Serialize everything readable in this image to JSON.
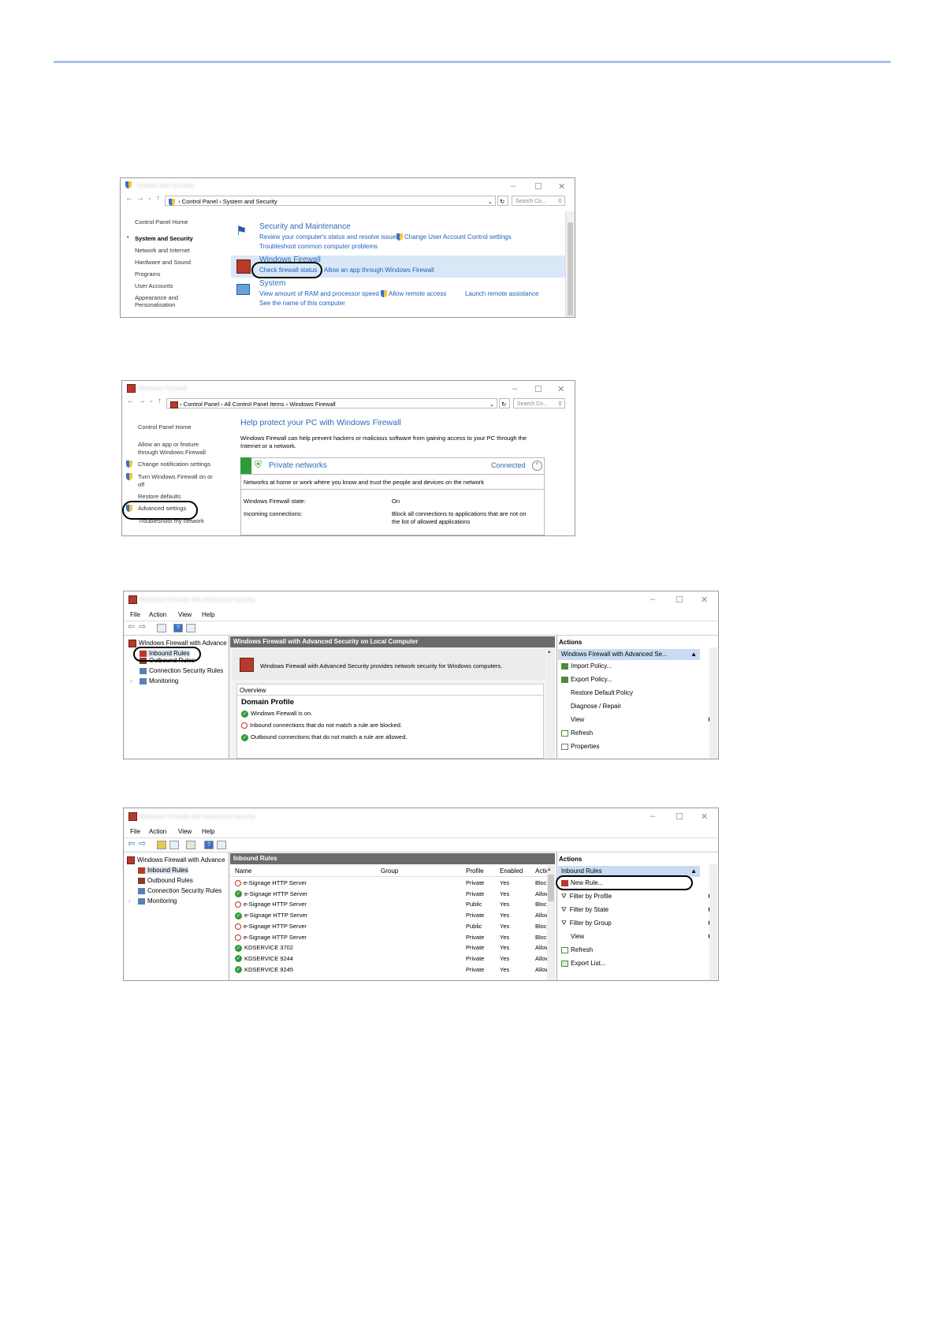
{
  "shot1": {
    "address": [
      "Control Panel",
      "System and Security"
    ],
    "search_placeholder": "Search Co...",
    "sidebar": [
      "Control Panel Home",
      "System and Security",
      "Network and Internet",
      "Hardware and Sound",
      "Programs",
      "User Accounts",
      "Appearance and",
      "Personalisation"
    ],
    "sections": [
      {
        "title": "Security and Maintenance",
        "links": [
          "Review your computer's status and resolve issues",
          "Change User Account Control settings",
          "Troubleshoot common computer problems"
        ]
      },
      {
        "title": "Windows Firewall",
        "links": [
          "Check firewall status",
          "Allow an app through Windows Firewall"
        ]
      },
      {
        "title": "System",
        "links": [
          "View amount of RAM and processor speed",
          "Allow remote access",
          "Launch remote assistance",
          "See the name of this computer"
        ]
      }
    ]
  },
  "shot2": {
    "address": [
      "Control Panel",
      "All Control Panel Items",
      "Windows Firewall"
    ],
    "search_placeholder": "Search Co...",
    "sidebar": [
      "Control Panel Home",
      "Allow an app or feature",
      "through Windows Firewall",
      "Change notification settings",
      "Turn Windows Firewall on or",
      "off",
      "Restore defaults",
      "Advanced settings",
      "Troubleshoot my network"
    ],
    "heading": "Help protect your PC with Windows Firewall",
    "intro": [
      "Windows Firewall can help prevent hackers or malicious software from gaining access to your PC through the",
      "Internet or a network."
    ],
    "network_title": "Private networks",
    "network_status": "Connected",
    "network_desc": "Networks at home or work where you know and trust the people and devices on the network",
    "rows": [
      {
        "label": "Windows Firewall state:",
        "value": "On"
      },
      {
        "label": "Incoming connections:",
        "value": "Block all connections to applications that are not on",
        "value2": "the list of allowed applications"
      }
    ]
  },
  "shot3": {
    "menu": [
      "File",
      "Action",
      "View",
      "Help"
    ],
    "tree": [
      "Windows Firewall with Advance",
      "Inbound Rules",
      "Outbound Rules",
      "Connection Security Rules",
      "Monitoring"
    ],
    "center_title": "Windows Firewall with Advanced Security on Local Computer",
    "center_desc": "Windows Firewall with Advanced Security provides network security for Windows computers.",
    "overview": "Overview",
    "profile": "Domain Profile",
    "status": [
      "Windows Firewall is on.",
      "Inbound connections that do not match a rule are blocked.",
      "Outbound connections that do not match a rule are allowed."
    ],
    "actions_title": "Actions",
    "actions_bar": "Windows Firewall with Advanced Se...",
    "actions": [
      "Import Policy...",
      "Export Policy...",
      "Restore Default Policy",
      "Diagnose / Repair",
      "View",
      "Refresh",
      "Properties"
    ]
  },
  "shot4": {
    "menu": [
      "File",
      "Action",
      "View",
      "Help"
    ],
    "tree": [
      "Windows Firewall with Advance",
      "Inbound Rules",
      "Outbound Rules",
      "Connection Security Rules",
      "Monitoring"
    ],
    "center_title": "Inbound Rules",
    "columns": [
      "Name",
      "Group",
      "Profile",
      "Enabled",
      "Action"
    ],
    "rows": [
      {
        "name": "e-Signage HTTP Server",
        "profile": "Private",
        "enabled": "Yes",
        "action": "Block",
        "ok": false
      },
      {
        "name": "e-Signage HTTP Server",
        "profile": "Private",
        "enabled": "Yes",
        "action": "Allow",
        "ok": true
      },
      {
        "name": "e-Signage HTTP Server",
        "profile": "Public",
        "enabled": "Yes",
        "action": "Block",
        "ok": false
      },
      {
        "name": "e-Signage HTTP Server",
        "profile": "Private",
        "enabled": "Yes",
        "action": "Allow",
        "ok": true
      },
      {
        "name": "e-Signage HTTP Server",
        "profile": "Public",
        "enabled": "Yes",
        "action": "Block",
        "ok": false
      },
      {
        "name": "e-Signage HTTP Server",
        "profile": "Private",
        "enabled": "Yes",
        "action": "Block",
        "ok": false
      },
      {
        "name": "KDSERVICE 3702",
        "profile": "Private",
        "enabled": "Yes",
        "action": "Allow",
        "ok": true
      },
      {
        "name": "KDSERVICE 9244",
        "profile": "Private",
        "enabled": "Yes",
        "action": "Allow",
        "ok": true
      },
      {
        "name": "KDSERVICE 9245",
        "profile": "Private",
        "enabled": "Yes",
        "action": "Allow",
        "ok": true
      }
    ],
    "actions_title": "Actions",
    "actions_bar": "Inbound Rules",
    "actions": [
      "New Rule...",
      "Filter by Profile",
      "Filter by State",
      "Filter by Group",
      "View",
      "Refresh",
      "Export List..."
    ]
  }
}
